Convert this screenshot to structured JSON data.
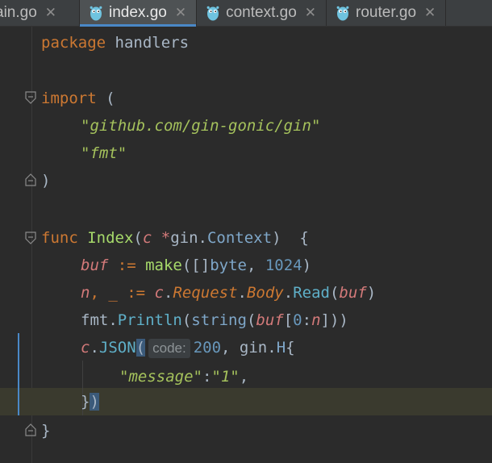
{
  "tabs": [
    {
      "label": "ain.go",
      "active": false
    },
    {
      "label": "index.go",
      "active": true
    },
    {
      "label": "context.go",
      "active": false
    },
    {
      "label": "router.go",
      "active": false
    }
  ],
  "close_glyph": "✕",
  "code": {
    "l1_kw": "package",
    "l1_name": " handlers",
    "l3_kw": "import",
    "l3_paren": " (",
    "l4_str": "\"github.com/gin-gonic/gin\"",
    "l5_str": "\"fmt\"",
    "l6_paren": ")",
    "l8_func": "func",
    "l8_name": "Index",
    "l8_open": "(",
    "l8_param": "c",
    "l8_star": " *",
    "l8_pkg": "gin.",
    "l8_type": "Context",
    "l8_close": ")  {",
    "l9_var": "buf",
    "l9_op": " := ",
    "l9_make": "make",
    "l9_args_open": "([]",
    "l9_byte": "byte",
    "l9_comma": ", ",
    "l9_num": "1024",
    "l9_close": ")",
    "l10_n": "n",
    "l10_rest": ", _ := ",
    "l10_c": "c",
    "l10_dot1": ".",
    "l10_req": "Request",
    "l10_dot2": ".",
    "l10_body": "Body",
    "l10_dot3": ".",
    "l10_read": "Read",
    "l10_open": "(",
    "l10_buf": "buf",
    "l10_close": ")",
    "l11_fmt": "fmt.",
    "l11_println": "Println",
    "l11_open": "(",
    "l11_string": "string",
    "l11_open2": "(",
    "l11_buf": "buf",
    "l11_idx_open": "[",
    "l11_zero": "0",
    "l11_colon": ":",
    "l11_n": "n",
    "l11_close": "]))",
    "l12_c": "c",
    "l12_dot": ".",
    "l12_json": "JSON",
    "l12_open": "(",
    "l12_hint": "code:",
    "l12_num": "200",
    "l12_rest": ", gin.",
    "l12_h": "H",
    "l12_brace": "{",
    "l13_key": "\"message\"",
    "l13_colon": ":",
    "l13_val": "\"1\"",
    "l13_comma": ",",
    "l14_brace": "}",
    "l14_paren": ")",
    "l15_brace": "}"
  }
}
